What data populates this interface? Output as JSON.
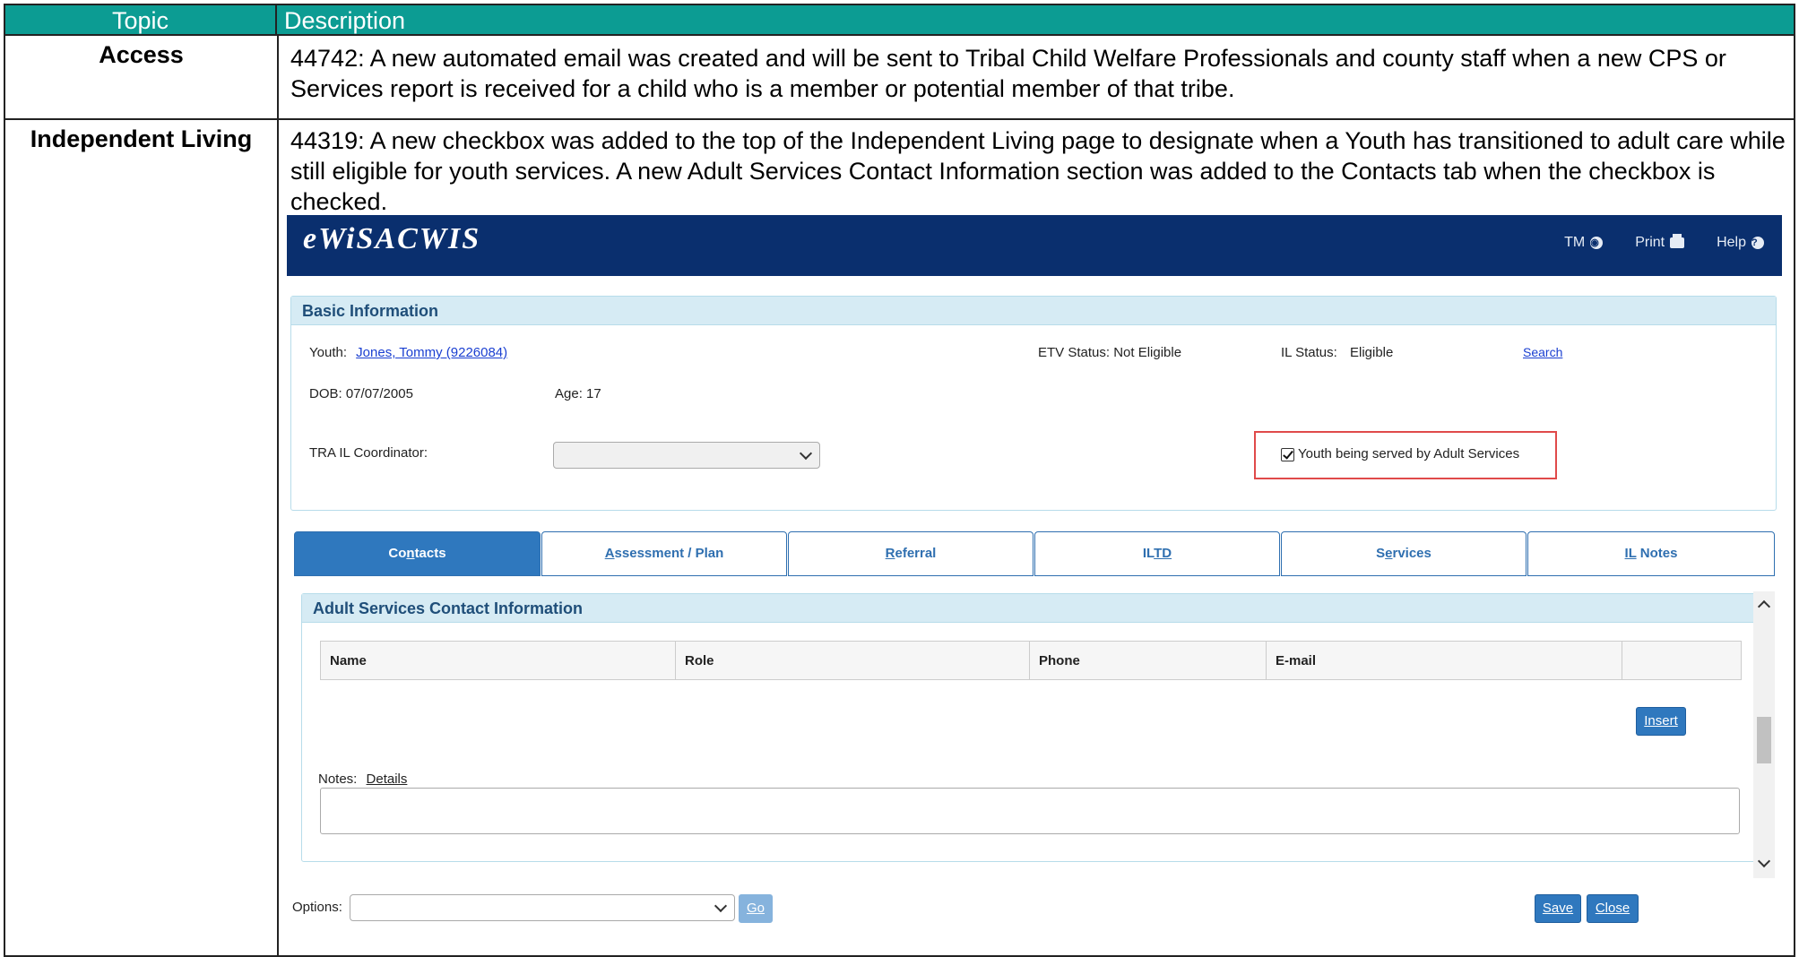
{
  "table": {
    "header_topic": "Topic",
    "header_description": "Description",
    "rows": [
      {
        "topic": "Access",
        "description": "44742: A new automated email was created and will be sent to Tribal Child Welfare Professionals and county staff when a new CPS or Services report is received for a child who is a member or potential member of that tribe."
      },
      {
        "topic": "Independent Living",
        "description": "44319: A new checkbox was added to the top of the Independent Living page to designate when a Youth has transitioned to adult care while still eligible for youth services. A new Adult Services Contact Information section was added to the Contacts tab when the checkbox is checked."
      }
    ]
  },
  "app": {
    "logo": "eWiSACWIS",
    "nav": {
      "tm": "TM",
      "print": "Print",
      "help": "Help"
    },
    "basic_info": {
      "title": "Basic Information",
      "youth_label": "Youth:",
      "youth_value": "Jones, Tommy (9226084)",
      "etv_status": "ETV Status: Not Eligible",
      "il_status_label": "IL Status:",
      "il_status_value": "Eligible",
      "search_link": "Search",
      "dob": "DOB: 07/07/2005",
      "age": "Age: 17",
      "coordinator_label": "TRA IL Coordinator:",
      "adult_services_checkbox": "Youth being served by Adult Services"
    },
    "tabs": [
      {
        "pre": "Co",
        "key": "n",
        "post": "tacts"
      },
      {
        "pre": "",
        "key": "A",
        "post": "ssessment / Plan"
      },
      {
        "pre": "",
        "key": "R",
        "post": "eferral"
      },
      {
        "pre": "IL",
        "key": "TD",
        "post": ""
      },
      {
        "pre": "S",
        "key": "e",
        "post": "rvices"
      },
      {
        "pre": "",
        "key": "IL",
        "post": " Notes"
      }
    ],
    "contacts": {
      "title": "Adult Services Contact Information",
      "columns": [
        "Name",
        "Role",
        "Phone",
        "E-mail",
        ""
      ],
      "insert_button": "Insert",
      "notes_label": "Notes:",
      "notes_link": "Details"
    },
    "footer": {
      "options_label": "Options:",
      "go_button": "Go",
      "save_button": "Save",
      "close_button": "Close"
    }
  }
}
